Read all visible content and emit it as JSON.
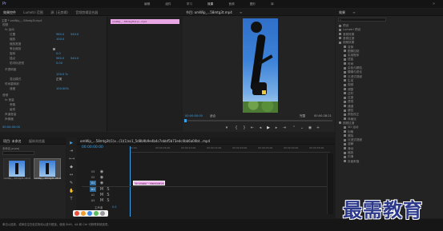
{
  "menubar": {
    "items": [
      "编辑",
      "组件",
      "学习",
      "效果",
      "音频",
      "图形",
      "库"
    ],
    "logo": "Pr"
  },
  "effect_controls": {
    "tabs": [
      "效果控件",
      "Lumetri 范围",
      "源: (无剪辑)",
      "音频剪辑混合器"
    ],
    "source_label": "主要 * omWip_...58mtg3t.mp4",
    "clip_label": "omWip_...58mtg3t(1)v...mp4",
    "rows": [
      "视频",
      "fx 运动",
      "位置",
      "缩放",
      "缩放宽度",
      "等比缩放",
      "旋转",
      "锚点",
      "防闪烁滤镜",
      "不透明度",
      "时间重映射",
      "音频",
      "fx 音量",
      "旁路",
      "级别",
      "声道音量",
      "声像器",
      "旋转",
      "锚点",
      "不透明度",
      "混合模式",
      "正常",
      "时间重映射",
      "速度",
      "声道音量"
    ],
    "values": [
      "960.0",
      "540.0",
      "100.0",
      "0.0",
      "960.0",
      "540.0",
      "0.00",
      "100.0 %",
      "100.00%"
    ],
    "timecode": "00:00:00:00"
  },
  "program": {
    "tabs": [
      "节目: omWip_...58mtg3t.mp4",
      "≡"
    ],
    "timecode_left": "00:00:00:00",
    "fit": "适合",
    "quality": "完整",
    "timecode_right": "00:00:28:21"
  },
  "effects": {
    "tabs": [
      "效果",
      "≡"
    ],
    "search_placeholder": "",
    "tree": [
      "预设",
      "Lumetri 预设",
      "音频效果",
      "音频过渡",
      "视频效果",
      "变换",
      "图像控制",
      "实用程序",
      "扭曲",
      "时间",
      "杂色与颗粒",
      "模糊与锐化",
      "沉浸式视频",
      "生成",
      "视频",
      "调整",
      "过时",
      "过渡",
      "透视",
      "通道",
      "键控",
      "颜色校正",
      "风格化",
      "视频过渡",
      "3D 运动",
      "划像",
      "擦除",
      "沉浸式视频",
      "溶解",
      "滑动",
      "缩放",
      "内滑",
      "页面剥落"
    ]
  },
  "project": {
    "tabs": [
      "项目: 未命名",
      "媒体浏览器",
      "库",
      "信息"
    ],
    "file_name": "未命名.prproj",
    "items": [
      {
        "name": "omWip_...58mtg3t...",
        "duration": "28:21"
      },
      {
        "name": "omWip_...58mtg3t...",
        "duration": "28:21"
      }
    ]
  },
  "timeline": {
    "tab": "omWip_...58mtg3t(1)v...(1)(1)sc1_5d8b9b9e4b4c7ebbf5b73edc4bb6a00bt...mp4",
    "timecode": "00:00:00:00",
    "ruler": [
      "00:00",
      "00:00:05:00",
      "00:00:10:00",
      "00:00:15:00",
      "00:00:20:00",
      "00:00:25:00",
      "00:00:30:00",
      "00:00:35:00"
    ],
    "tracks": [
      "V3",
      "V2",
      "V1",
      "A1",
      "A2",
      "A3"
    ],
    "clip_video": "fx omWip_...58mtg3t.mp4 [V]",
    "clip_audio": "",
    "master_label": "主声道",
    "master_value": "0.0"
  },
  "status": {
    "text": "单击以选择，或单击空白处并拖动以进行框选。使用 Shift、Alt 和 Ctrl 可获得其他选项。"
  },
  "watermark": {
    "text": "最需教育"
  },
  "colors": {
    "accent": "#3aa0e8",
    "clip": "#e8a6e4",
    "selected_clip": "#c28ad6",
    "timeline_bg": "#1c1c1c",
    "watermark": "#2d3a8c"
  }
}
